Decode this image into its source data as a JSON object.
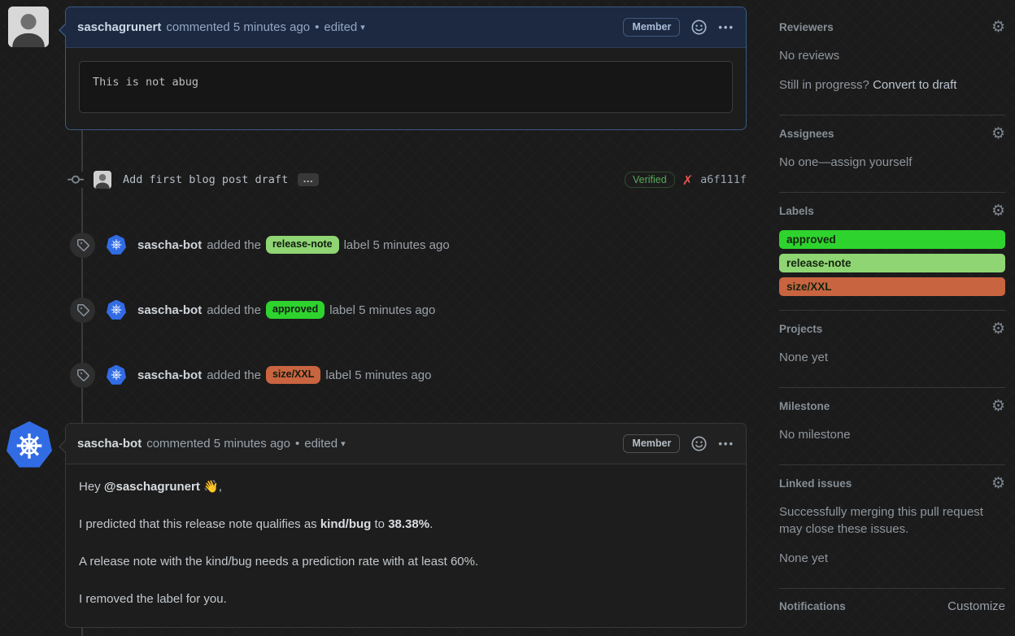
{
  "icons": {
    "caret_down": "▾",
    "kebab": "•••",
    "gear": "⚙",
    "helm": "⎈",
    "x_mark": "✗",
    "dot": "•",
    "expander": "…"
  },
  "comments": {
    "first": {
      "author": "saschagrunert",
      "meta": "commented 5 minutes ago",
      "edited": "edited",
      "member": "Member",
      "code": "This is not abug"
    },
    "second": {
      "author": "sascha-bot",
      "meta": "commented 5 minutes ago",
      "edited": "edited",
      "member": "Member",
      "p1_pre": "Hey ",
      "p1_mention": "@saschagrunert",
      "p1_post": " 👋,",
      "p2_pre": "I predicted that this release note qualifies as ",
      "p2_bold1": "kind/bug",
      "p2_mid": " to ",
      "p2_bold2": "38.38%",
      "p2_post": ".",
      "p3": "A release note with the kind/bug needs a prediction rate with at least 60%.",
      "p4": "I removed the label for you."
    }
  },
  "commit": {
    "message": "Add first blog post draft",
    "verified": "Verified",
    "sha": "a6f111f"
  },
  "events": [
    {
      "actor": "sascha-bot",
      "action": "added the",
      "label": "release-note",
      "color": "#8fd573",
      "suffix": "label 5 minutes ago"
    },
    {
      "actor": "sascha-bot",
      "action": "added the",
      "label": "approved",
      "color": "#2ed32e",
      "suffix": "label 5 minutes ago"
    },
    {
      "actor": "sascha-bot",
      "action": "added the",
      "label": "size/XXL",
      "color": "#c96440",
      "suffix": "label 5 minutes ago"
    }
  ],
  "sidebar": {
    "reviewers": {
      "title": "Reviewers",
      "empty": "No reviews",
      "progress_pre": "Still in progress? ",
      "convert": "Convert to draft"
    },
    "assignees": {
      "title": "Assignees",
      "empty_pre": "No one—",
      "assign": "assign yourself"
    },
    "labels": {
      "title": "Labels",
      "items": [
        {
          "name": "approved",
          "color": "#2ed32e"
        },
        {
          "name": "release-note",
          "color": "#8fd573"
        },
        {
          "name": "size/XXL",
          "color": "#c96440"
        }
      ]
    },
    "projects": {
      "title": "Projects",
      "empty": "None yet"
    },
    "milestone": {
      "title": "Milestone",
      "empty": "No milestone"
    },
    "linked_issues": {
      "title": "Linked issues",
      "description": "Successfully merging this pull request may close these issues.",
      "empty": "None yet"
    },
    "notifications": {
      "title": "Notifications",
      "customize": "Customize"
    }
  }
}
